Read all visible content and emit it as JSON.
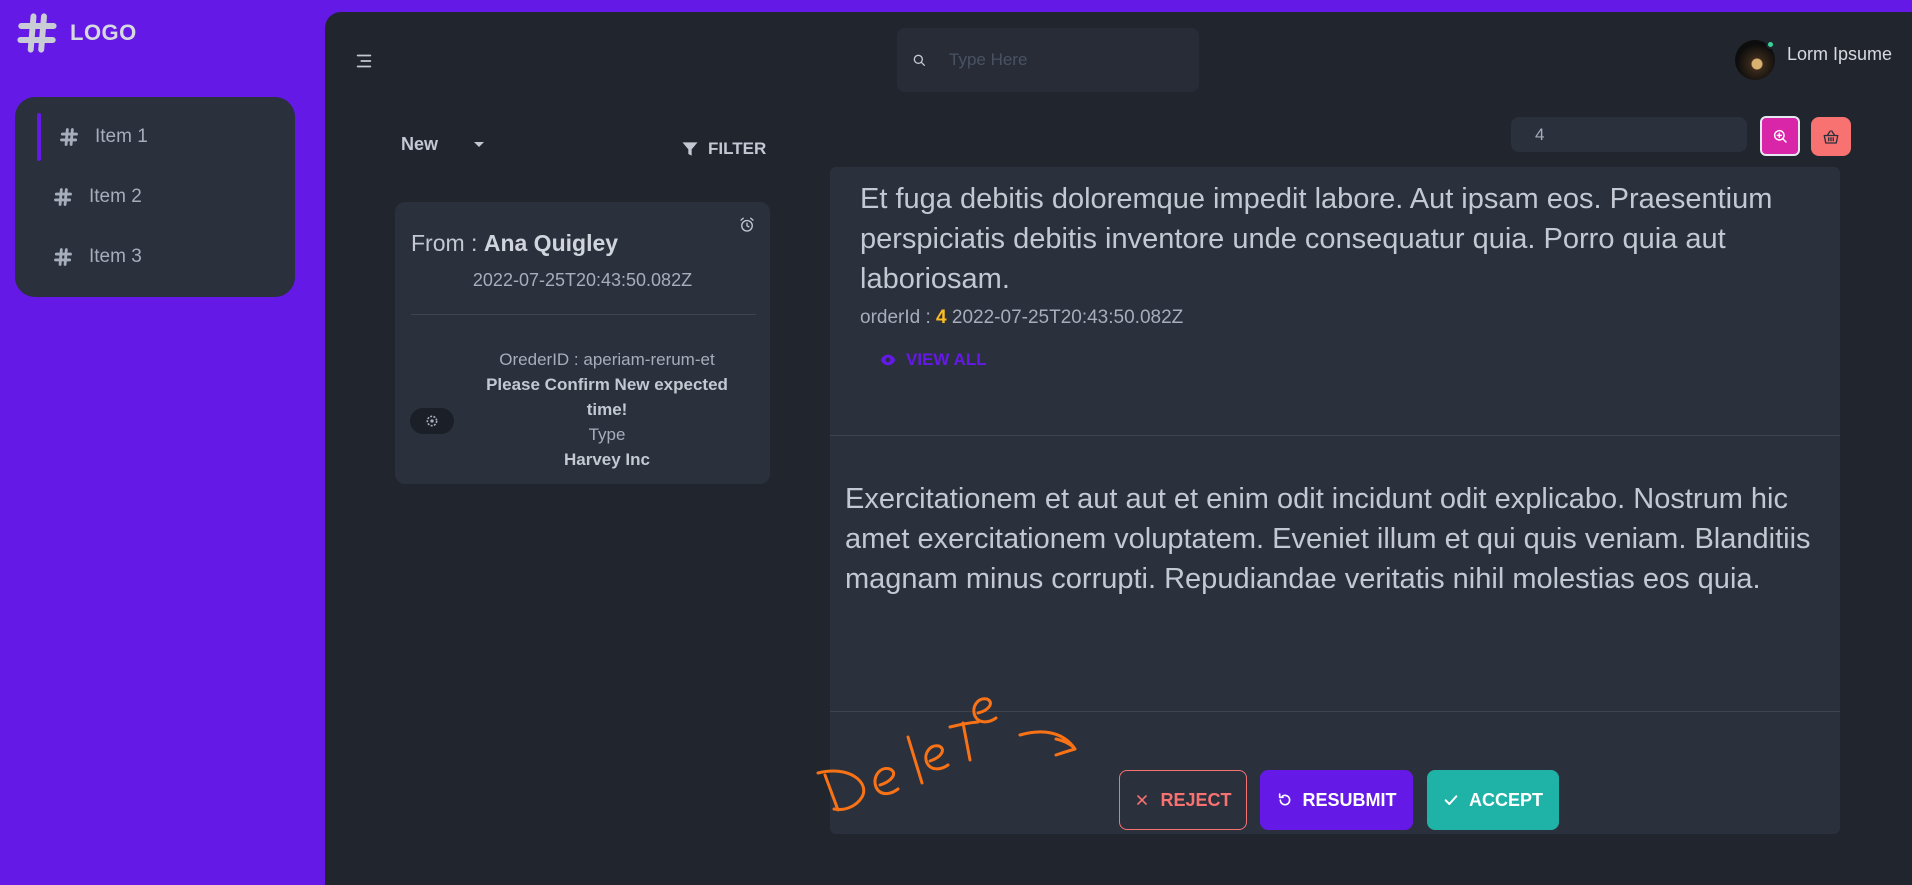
{
  "logo": {
    "text": "LOGO",
    "icon": "hash-icon"
  },
  "sidebar": {
    "items": [
      {
        "label": "Item 1",
        "icon": "hash-icon",
        "active": true
      },
      {
        "label": "Item 2",
        "icon": "hash-icon",
        "active": false
      },
      {
        "label": "Item 3",
        "icon": "hash-icon",
        "active": false
      }
    ]
  },
  "header": {
    "search_placeholder": "Type Here",
    "user_name": "Lorm Ipsume"
  },
  "list": {
    "status_select": "New",
    "filter_label": "FILTER",
    "card": {
      "from_label": "From :",
      "from_name": "Ana Quigley",
      "date": "2022-07-25T20:43:50.082Z",
      "order_line": "OrederID : aperiam-rerum-et",
      "message": "Please Confirm New expected time!",
      "type_label": "Type",
      "company": "Harvey Inc"
    }
  },
  "tools": {
    "number_value": "4"
  },
  "detail": {
    "paragraph1": "Et fuga debitis doloremque impedit labore. Aut ipsam eos. Praesentium perspiciatis debitis inventore unde consequatur quia. Porro quia aut laboriosam.",
    "order_label": "orderId :",
    "order_id": "4",
    "order_date": "2022-07-25T20:43:50.082Z",
    "view_all": "VIEW ALL",
    "paragraph2": "Exercitationem et aut aut et enim odit incidunt odit explicabo. Nostrum hic amet exercitationem voluptatem. Eveniet illum et qui quis veniam. Blanditiis magnam minus corrupti. Repudiandae veritatis nihil molestias eos quia."
  },
  "actions": {
    "reject": "REJECT",
    "resubmit": "RESUBMIT",
    "accept": "ACCEPT"
  },
  "annotation": {
    "text": "Delete",
    "color": "#f97316"
  },
  "colors": {
    "primary": "#6419e6",
    "secondary": "#d926a9",
    "accent": "#1fb2a6",
    "error": "#f87272",
    "warning": "#fbbd23",
    "success": "#36d399",
    "base_100": "#2a303c",
    "base_200": "#20252e"
  }
}
